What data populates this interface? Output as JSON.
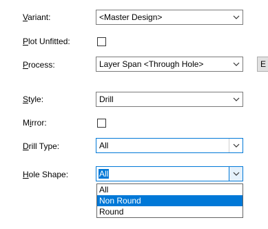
{
  "form": {
    "variant": {
      "label_u": "V",
      "label_rest": "ariant:",
      "value": "<Master Design>"
    },
    "plot_unfitted": {
      "label_u": "P",
      "label_rest": "lot Unfitted:"
    },
    "process": {
      "label_u": "P",
      "label_rest": "rocess:",
      "value": "Layer Span <Through Hole>",
      "side_button": "E"
    },
    "style": {
      "label_u": "S",
      "label_rest": "tyle:",
      "value": "Drill"
    },
    "mirror": {
      "label_pre": "M",
      "label_u": "i",
      "label_rest": "rror:"
    },
    "drill_type": {
      "label_u": "D",
      "label_rest": "rill Type:",
      "value": "All"
    },
    "hole_shape": {
      "label_u": "H",
      "label_rest": "ole Shape:",
      "value": "All"
    }
  },
  "dropdown": {
    "options": [
      "All",
      "Non Round",
      "Round"
    ],
    "highlighted": "Non Round"
  }
}
